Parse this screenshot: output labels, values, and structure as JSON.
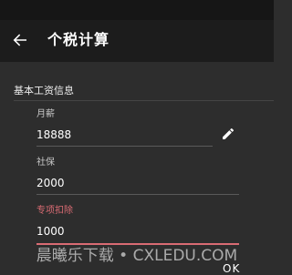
{
  "app_bar": {
    "title": "个税计算",
    "back_icon": "arrow-back-icon"
  },
  "section": {
    "title": "基本工资信息"
  },
  "fields": {
    "salary": {
      "label": "月薪",
      "value": "18888",
      "action_icon": "pencil-icon"
    },
    "insurance": {
      "label": "社保",
      "value": "2000"
    },
    "deduction": {
      "label": "专项扣除",
      "value": "1000",
      "accent_color": "#d96b73"
    }
  },
  "watermark": {
    "text": "晨曦乐下载 • CXLEDU.COM"
  },
  "dialog": {
    "ok_label": "OK"
  },
  "colors": {
    "background": "#2d2d2d",
    "app_bar": "#1c1c1c",
    "status_bar": "#161616",
    "accent": "#d96b73"
  }
}
